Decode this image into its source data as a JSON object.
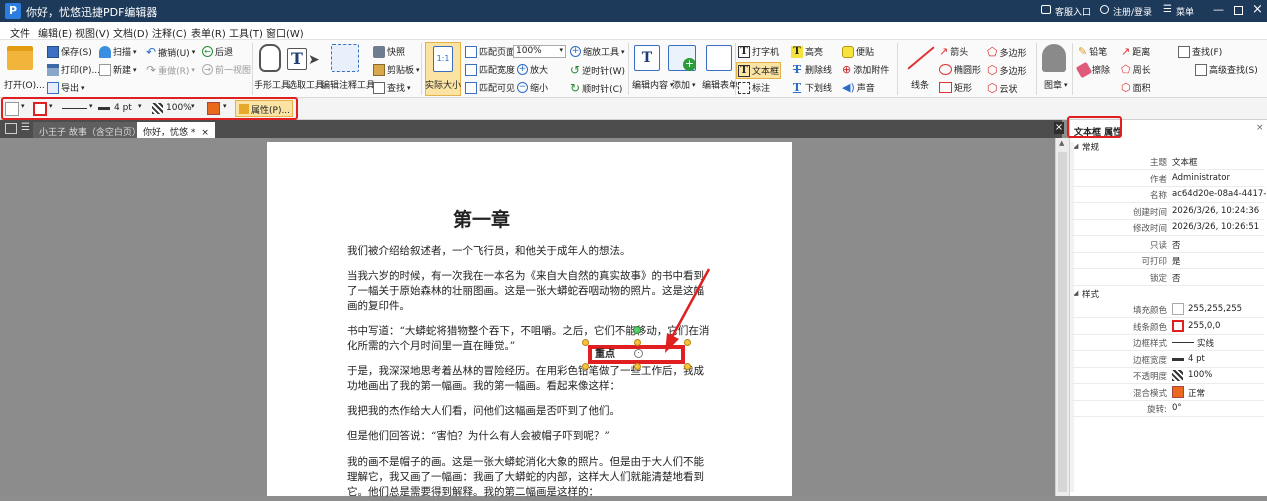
{
  "titlebar": {
    "app_title": "你好，忧悠迅捷PDF编辑器",
    "service": "客服入口",
    "login": "注册/登录",
    "menu": "菜单"
  },
  "menubar": [
    "文件",
    "编辑(E)",
    "视图(V)",
    "文档(D)",
    "注释(C)",
    "表单(R)",
    "工具(T)",
    "窗口(W)"
  ],
  "ribbon": {
    "open": "打开(O)...",
    "save": "保存(S)",
    "print": "打印(P)...",
    "export": "导出",
    "scan": "扫描",
    "new": "新建",
    "undo": "撤销(U)",
    "redo": "重做(R)",
    "back": "后退",
    "forward": "前一视图",
    "hand": "手形工具",
    "select": "选取工具",
    "edit_annot": "编辑注释工具",
    "snapshot": "快照",
    "clipboard": "剪贴板",
    "find": "查找",
    "actual_size": "实际大小",
    "fit_page": "匹配页面",
    "fit_width": "匹配宽度",
    "fit_visible": "匹配可见",
    "zoom_value": "100%",
    "zoom_tool": "缩放工具",
    "zoom_in": "放大",
    "zoom_out": "缩小",
    "rotate_ccw": "逆时针(W)",
    "rotate_cw": "顺时针(C)",
    "edit_content": "编辑内容",
    "add": "添加",
    "edit_form": "编辑表单",
    "typewriter": "打字机",
    "textbox": "文本框",
    "callout": "标注",
    "highlight": "高亮",
    "strike": "删除线",
    "underline": "下划线",
    "note": "便贴",
    "attach": "添加附件",
    "sound": "声音",
    "line": "线条",
    "arrow": "箭头",
    "ellipse": "椭圆形",
    "rect": "矩形",
    "polygon": "多边形",
    "polyline": "多边形",
    "cloud": "云状",
    "stamp": "图章",
    "pencil": "铅笔",
    "eraser": "擦除",
    "distance": "距离",
    "perimeter": "周长",
    "area": "面积",
    "search": "查找(F)",
    "adv_search": "高级查找(S)"
  },
  "propbar": {
    "line_width": "4 pt",
    "opacity": "100%",
    "properties": "属性(P)..."
  },
  "tabs": [
    "小王子 故事（含空白页）",
    "你好，忧悠 *"
  ],
  "page": {
    "chapter": "第一章",
    "paras": [
      [
        "我们被介绍给叙述者，一个飞行员，和他关于成年人的想法。"
      ],
      [
        "当我六岁的时候，有一次我在一本名为《来自大自然的真实故事》的书中看到",
        "了一幅关于原始森林的壮丽图画。这是一张大蟒蛇吞咽动物的照片。这是这幅",
        "画的复印件。"
      ],
      [
        "书中写道：“大蟒蛇将猎物整个吞下，不咀嚼。之后，它们不能移动，它们在消",
        "化所需的六个月时间里一直在睡觉。”"
      ],
      [
        "于是，我深深地思考着丛林的冒险经历。在用彩色铅笔做了一些工作后，我成",
        "功地画出了我的第一幅画。我的第一幅画。看起来像这样："
      ],
      [
        "我把我的杰作给大人们看，问他们这幅画是否吓到了他们。"
      ],
      [
        "但是他们回答说：“害怕？为什么有人会被帽子吓到呢？”"
      ],
      [
        "我的画不是帽子的画。这是一张大蟒蛇消化大象的照片。但是由于大人们不能",
        "理解它，我又画了一幅画：我画了大蟒蛇的内部，这样大人们就能清楚地看到",
        "它。他们总是需要得到解释。我的第二幅画是这样的："
      ]
    ],
    "textbox": "重点"
  },
  "panel": {
    "title": "文本框 属性",
    "sec_general": "常规",
    "sec_style": "样式",
    "rows": [
      {
        "label": "主题",
        "value": "文本框"
      },
      {
        "label": "作者",
        "value": "Administrator"
      },
      {
        "label": "名称",
        "value": "ac64d20e-08a4-4417-9331e1..."
      },
      {
        "label": "创建时间",
        "value": "2026/3/26, 10:24:36"
      },
      {
        "label": "修改时间",
        "value": "2026/3/26, 10:26:51"
      },
      {
        "label": "只读",
        "value": "否"
      },
      {
        "label": "可打印",
        "value": "是"
      },
      {
        "label": "锁定",
        "value": "否"
      }
    ],
    "style_rows": [
      {
        "label": "填充颜色",
        "value": "255,255,255"
      },
      {
        "label": "线条颜色",
        "value": "255,0,0"
      },
      {
        "label": "边框样式",
        "value": "实线"
      },
      {
        "label": "边框宽度",
        "value": "4 pt"
      },
      {
        "label": "不透明度",
        "value": "100%"
      },
      {
        "label": "混合模式",
        "value": "正常"
      },
      {
        "label": "旋转:",
        "value": "0°"
      }
    ]
  },
  "colors": {
    "accent": "#2b6cc4",
    "annot_red": "#e02020",
    "title_bg": "#1e3a5a",
    "highlight_yellow": "#f6c343"
  }
}
